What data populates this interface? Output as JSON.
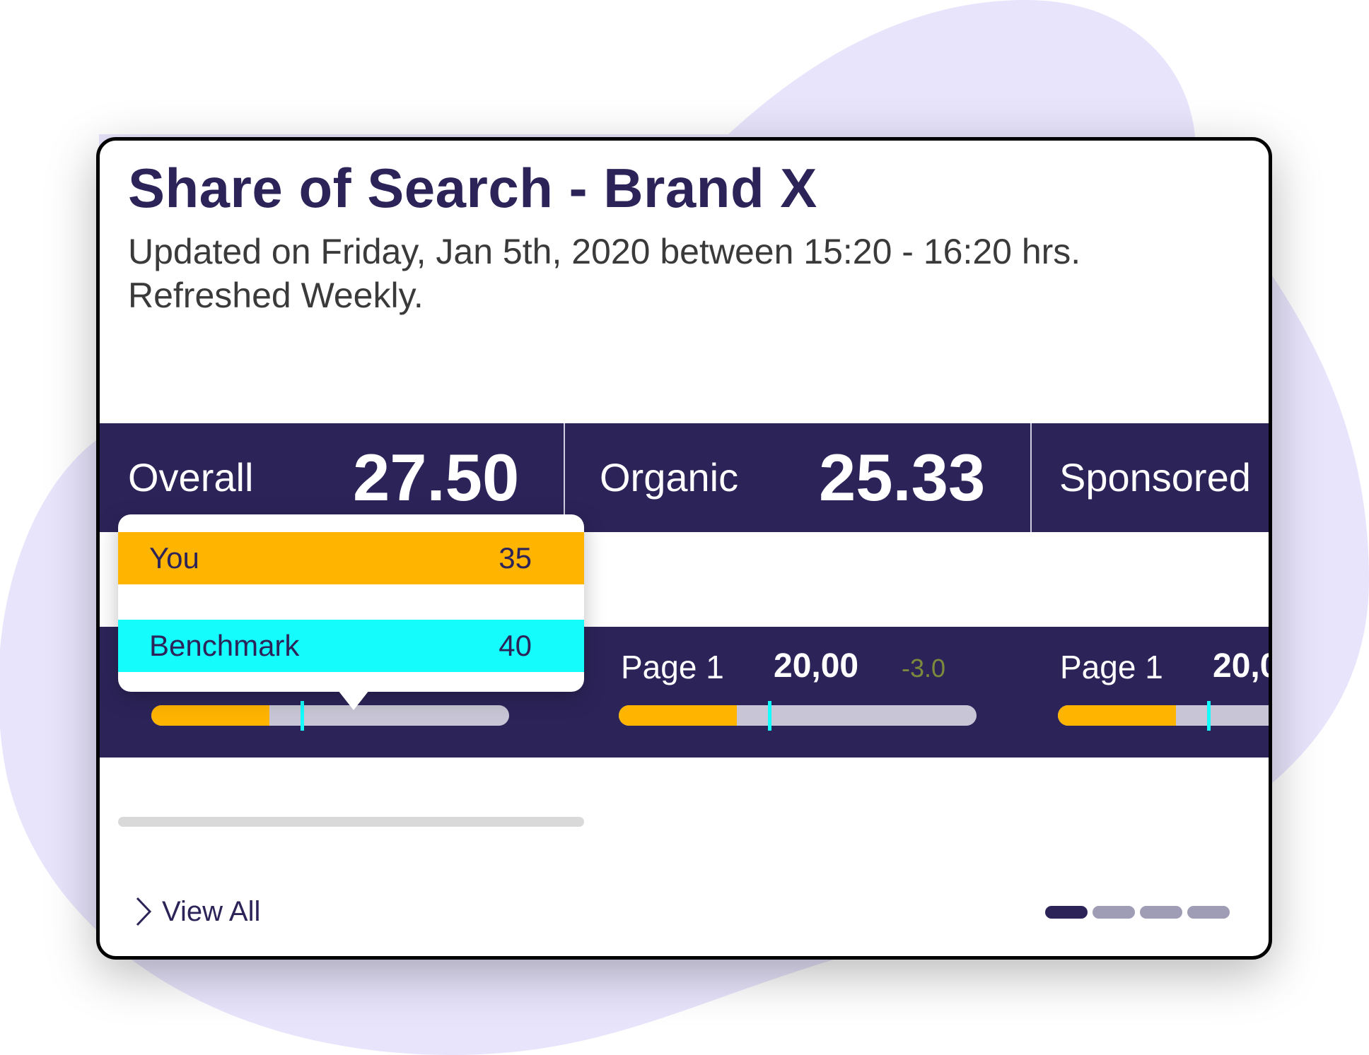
{
  "header": {
    "title": "Share of Search - Brand X",
    "subtitle_line1": "Updated on Friday, Jan 5th, 2020 between 15:20 - 16:20 hrs.",
    "subtitle_line2": "Refreshed Weekly."
  },
  "metrics": [
    {
      "label": "Overall",
      "value": "27.50"
    },
    {
      "label": "Organic",
      "value": "25.33"
    },
    {
      "label": "Sponsored",
      "value": ""
    }
  ],
  "pages": [
    {
      "label": "",
      "value": "",
      "delta": "",
      "fill_percent": 33,
      "benchmark_percent": 42
    },
    {
      "label": "Page 1",
      "value": "20,00",
      "delta": "-3.0",
      "fill_percent": 33,
      "benchmark_percent": 42
    },
    {
      "label": "Page 1",
      "value": "20,0",
      "delta": "",
      "fill_percent": 33,
      "benchmark_percent": 42
    }
  ],
  "tooltip": {
    "rows": [
      {
        "name": "You",
        "value": "35",
        "color": "#ffb400"
      },
      {
        "name": "Benchmark",
        "value": "40",
        "color": "#14fcfc"
      }
    ]
  },
  "footer": {
    "view_all_label": "View All",
    "pagination": {
      "total": 4,
      "active": 1
    }
  },
  "colors": {
    "navy": "#2c2459",
    "you": "#ffb400",
    "benchmark": "#14fcfc",
    "blob": "#e8e4fc"
  }
}
